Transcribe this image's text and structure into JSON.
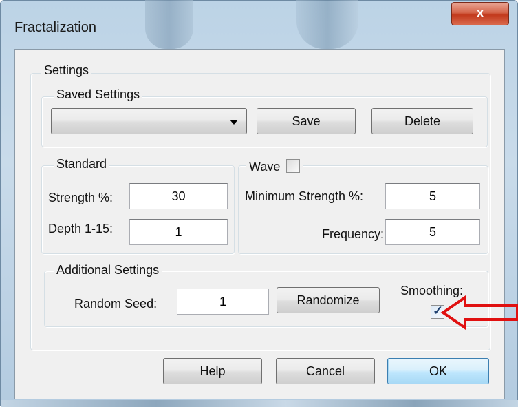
{
  "window": {
    "title": "Fractalization",
    "close_glyph": "x"
  },
  "settings_group": {
    "label": "Settings"
  },
  "saved_settings": {
    "label": "Saved Settings",
    "dropdown_value": "",
    "save_label": "Save",
    "delete_label": "Delete"
  },
  "standard": {
    "label": "Standard",
    "strength_label": "Strength  %:",
    "strength_value": "30",
    "depth_label": "Depth 1-15:",
    "depth_value": "1"
  },
  "wave": {
    "label": "Wave",
    "checked": false,
    "min_strength_label": "Minimum Strength %:",
    "min_strength_value": "5",
    "frequency_label": "Frequency:",
    "frequency_value": "5"
  },
  "additional": {
    "label": "Additional Settings",
    "seed_label": "Random Seed:",
    "seed_value": "1",
    "randomize_label": "Randomize",
    "smoothing_label": "Smoothing:",
    "smoothing_checked": true
  },
  "buttons": {
    "help": "Help",
    "cancel": "Cancel",
    "ok": "OK"
  },
  "annotation": {
    "arrow_color": "#e01010"
  }
}
